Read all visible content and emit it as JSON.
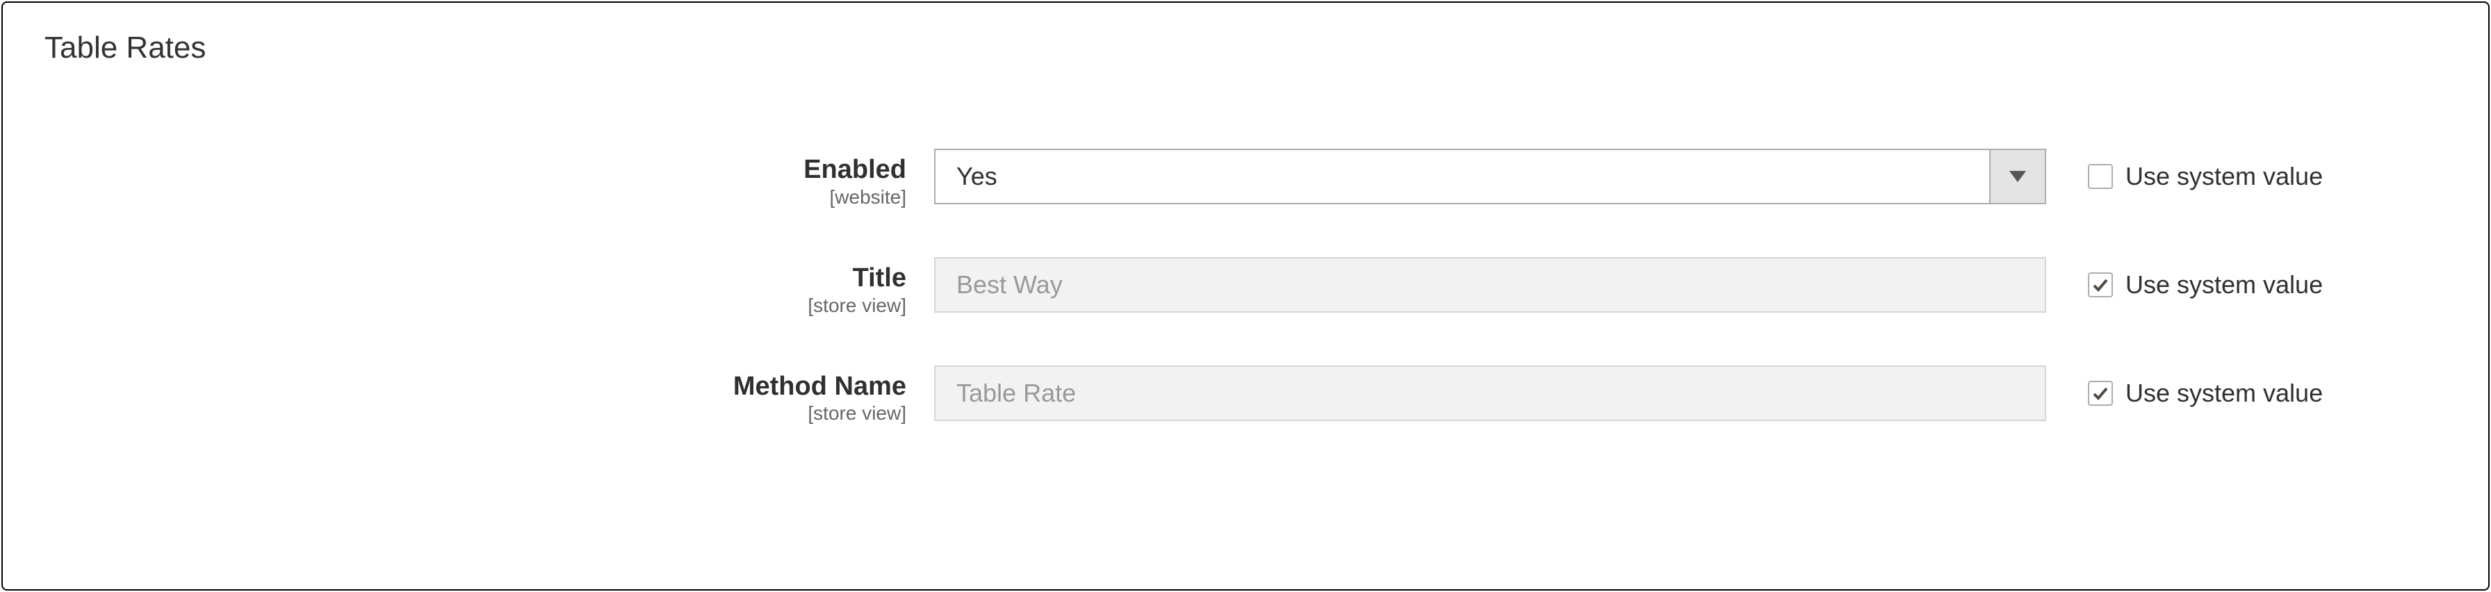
{
  "section": {
    "title": "Table Rates"
  },
  "labels": {
    "use_system_value": "Use system value"
  },
  "fields": {
    "enabled": {
      "label": "Enabled",
      "scope": "[website]",
      "value": "Yes",
      "use_system": false
    },
    "title": {
      "label": "Title",
      "scope": "[store view]",
      "value": "Best Way",
      "use_system": true
    },
    "method_name": {
      "label": "Method Name",
      "scope": "[store view]",
      "value": "Table Rate",
      "use_system": true
    }
  }
}
